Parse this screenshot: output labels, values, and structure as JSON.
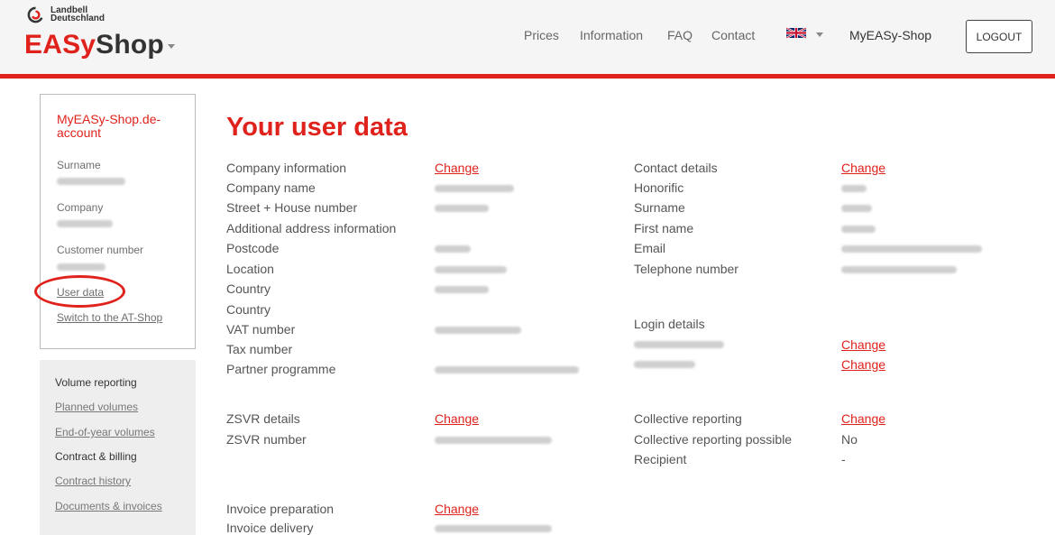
{
  "header": {
    "brand_line1": "Landbell",
    "brand_line2": "Deutschland",
    "brand_easy": "EASy",
    "brand_shop": "Shop",
    "nav": [
      "Prices",
      "Information",
      "FAQ",
      "Contact"
    ],
    "myshop": "MyEASy-Shop",
    "logout": "LOGOUT",
    "accent_color": "#e0221c"
  },
  "sidebar": {
    "account_title": "MyEASy-Shop.de-account",
    "surname_label": "Surname",
    "company_label": "Company",
    "customer_number_label": "Customer number",
    "user_data_link": "User data",
    "switch_link": "Switch to the AT-Shop"
  },
  "menu": {
    "volume_reporting": "Volume reporting",
    "planned_volumes": "Planned volumes",
    "end_of_year": "End-of-year volumes",
    "contract_billing": "Contract & billing",
    "contract_history": "Contract history",
    "documents": "Documents & invoices"
  },
  "main": {
    "title": "Your user data",
    "change": "Change",
    "left_labels": [
      "Company information",
      "Company name",
      "Street + House number",
      "Additional address information",
      "Postcode",
      "Location",
      "Country",
      "Country",
      "VAT number",
      "Tax number",
      "Partner programme"
    ],
    "right_labels": [
      "Contact details",
      "Honorific",
      "Surname",
      "First name",
      "Email",
      "Telephone number"
    ],
    "login_details": "Login details",
    "zsvr_details": "ZSVR details",
    "zsvr_number": "ZSVR number",
    "collective_reporting": "Collective reporting",
    "collective_possible": "Collective reporting possible",
    "collective_possible_value": "No",
    "recipient": "Recipient",
    "recipient_value": "-",
    "invoice_preparation": "Invoice preparation",
    "invoice_delivery": "Invoice delivery"
  }
}
